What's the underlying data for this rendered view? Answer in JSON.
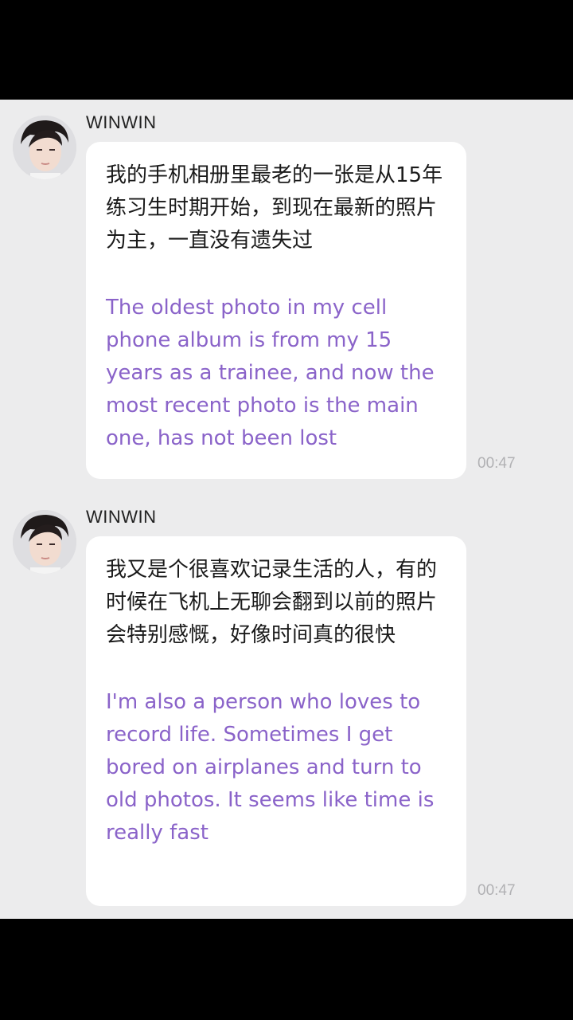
{
  "messages": [
    {
      "sender": "WINWIN",
      "text_zh": "我的手机相册里最老的一张是从15年练习生时期开始，到现在最新的照片为主，一直没有遗失过",
      "text_en": "The oldest photo in my cell phone album is from my 15 years as a trainee, and now the most recent photo is the main one, has not been lost",
      "time": "00:47"
    },
    {
      "sender": "WINWIN",
      "text_zh": "我又是个很喜欢记录生活的人，有的时候在飞机上无聊会翻到以前的照片 会特别感慨，好像时间真的很快",
      "text_en": "I'm also a person who loves to record life. Sometimes I get bored on airplanes and turn to old photos. It seems like time is really fast",
      "time": "00:47"
    }
  ]
}
